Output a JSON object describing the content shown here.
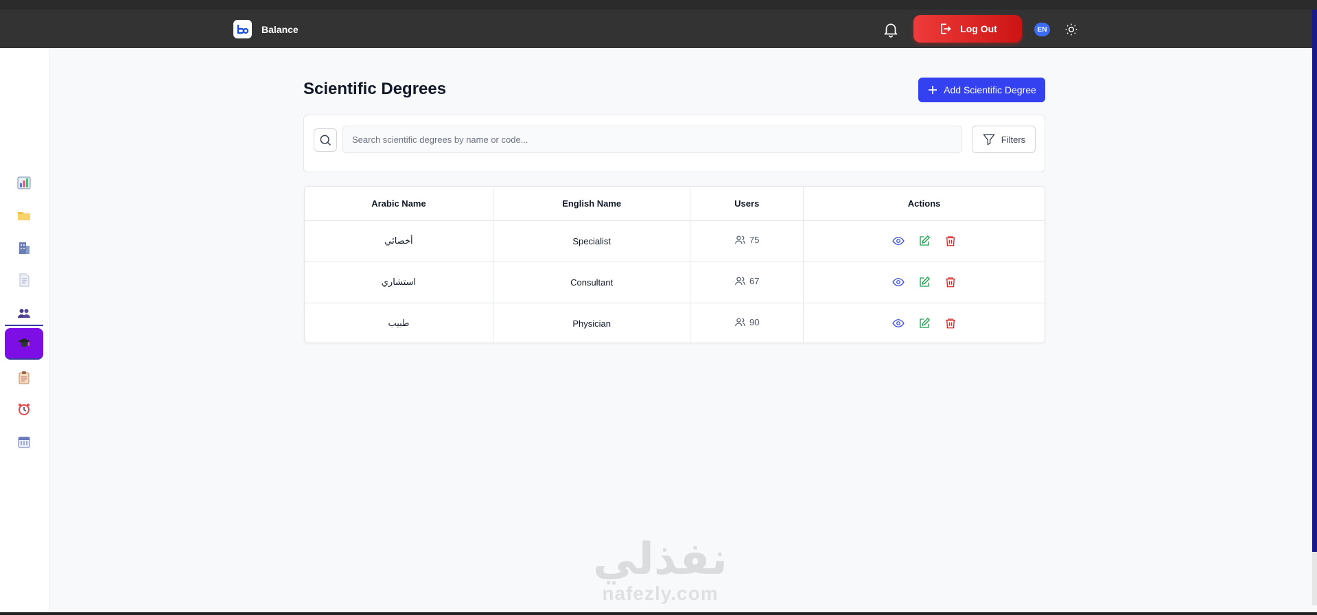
{
  "header": {
    "brand_name": "Balance",
    "logout_label": "Log Out",
    "language": "EN"
  },
  "sidebar": {
    "items": [
      {
        "name": "dashboard",
        "icon": "bar-chart-icon"
      },
      {
        "name": "files",
        "icon": "folder-icon"
      },
      {
        "name": "departments",
        "icon": "building-icon"
      },
      {
        "name": "documents",
        "icon": "document-icon"
      },
      {
        "name": "users",
        "icon": "people-icon"
      },
      {
        "name": "scientific-degrees",
        "icon": "graduation-icon",
        "active": true
      },
      {
        "name": "reports",
        "icon": "clipboard-icon"
      },
      {
        "name": "shifts",
        "icon": "alarm-clock-icon"
      },
      {
        "name": "calendar",
        "icon": "calendar-icon"
      }
    ]
  },
  "page": {
    "title": "Scientific Degrees",
    "add_button_label": "Add Scientific Degree"
  },
  "search": {
    "placeholder": "Search scientific degrees by name or code...",
    "value": "",
    "filters_label": "Filters"
  },
  "table": {
    "columns": [
      "Arabic Name",
      "English Name",
      "Users",
      "Actions"
    ],
    "rows": [
      {
        "arabic": "أخصائي",
        "english": "Specialist",
        "users": "75"
      },
      {
        "arabic": "استشاري",
        "english": "Consultant",
        "users": "67"
      },
      {
        "arabic": "طبيب",
        "english": "Physician",
        "users": "90"
      }
    ]
  },
  "watermark": {
    "arabic": "نفذلي",
    "english": "nafezly.com"
  },
  "colors": {
    "primary": "#3341f0",
    "logout": "#e02424",
    "sidebar_active": "#7d0ee6",
    "view": "#3b4fd8",
    "edit": "#16a34a",
    "delete": "#dc2626"
  }
}
